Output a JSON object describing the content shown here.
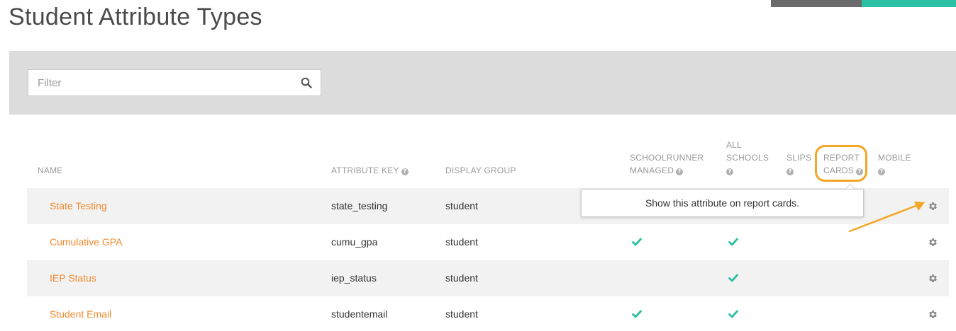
{
  "page": {
    "title": "Student Attribute Types"
  },
  "filter": {
    "placeholder": "Filter",
    "value": ""
  },
  "columns": {
    "name": "NAME",
    "attribute_key": "ATTRIBUTE KEY",
    "display_group": "DISPLAY GROUP",
    "schoolrunner_managed": [
      "SCHOOLRUNNER",
      "MANAGED"
    ],
    "all_schools": [
      "ALL",
      "SCHOOLS"
    ],
    "slips": "SLIPS",
    "report_cards": [
      "REPORT",
      "CARDS"
    ],
    "mobile": "MOBILE"
  },
  "rows": [
    {
      "name": "State Testing",
      "key": "state_testing",
      "group": "student",
      "schoolrunner_managed": false,
      "all_schools": false,
      "slips": false,
      "report_cards": false,
      "mobile": false
    },
    {
      "name": "Cumulative GPA",
      "key": "cumu_gpa",
      "group": "student",
      "schoolrunner_managed": true,
      "all_schools": true,
      "slips": false,
      "report_cards": false,
      "mobile": false
    },
    {
      "name": "IEP Status",
      "key": "iep_status",
      "group": "student",
      "schoolrunner_managed": false,
      "all_schools": true,
      "slips": false,
      "report_cards": false,
      "mobile": false
    },
    {
      "name": "Student Email",
      "key": "studentemail",
      "group": "student",
      "schoolrunner_managed": true,
      "all_schools": true,
      "slips": false,
      "report_cards": false,
      "mobile": false
    }
  ],
  "tooltip": {
    "text": "Show this attribute on report cards."
  },
  "icons": {
    "search": "search-icon",
    "help": "question-circle-icon",
    "check": "check-icon",
    "settings": "gear-icon",
    "annotation": "arrow-icon"
  },
  "colors": {
    "accent_orange": "#f0892d",
    "highlight_orange": "#f5a623",
    "teal": "#2bbfa3",
    "panel_gray": "#dcdcdc",
    "row_shade": "#f2f2f2"
  }
}
